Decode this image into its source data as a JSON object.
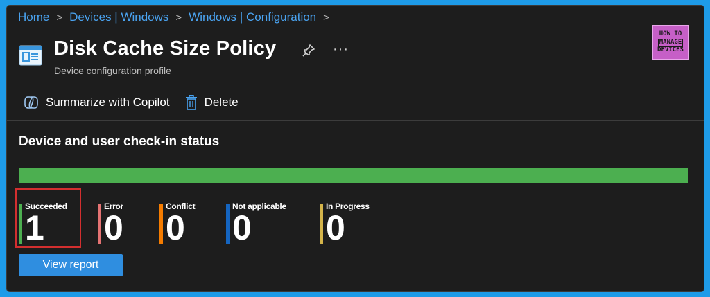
{
  "breadcrumb": {
    "items": [
      "Home",
      "Devices | Windows",
      "Windows | Configuration"
    ]
  },
  "header": {
    "title": "Disk Cache Size Policy",
    "subtitle": "Device configuration profile",
    "more_label": "···",
    "logo": {
      "line1": "HOW TO",
      "line2": "MANAGE",
      "line3": "DEVICES"
    }
  },
  "toolbar": {
    "copilot_label": "Summarize with Copilot",
    "delete_label": "Delete"
  },
  "status": {
    "title": "Device and user check-in status",
    "progress_fraction": 1.0,
    "items": [
      {
        "label": "Succeeded",
        "value": "1",
        "color": "#4caf50"
      },
      {
        "label": "Error",
        "value": "0",
        "color": "#e57373"
      },
      {
        "label": "Conflict",
        "value": "0",
        "color": "#f57c00"
      },
      {
        "label": "Not applicable",
        "value": "0",
        "color": "#1565c0"
      },
      {
        "label": "In Progress",
        "value": "0",
        "color": "#d4b44a"
      }
    ]
  },
  "actions": {
    "view_report_label": "View report"
  },
  "colors": {
    "accent": "#2f8ee0",
    "link": "#4aa3f0",
    "success": "#4caf50",
    "highlight": "#d32f2f"
  }
}
